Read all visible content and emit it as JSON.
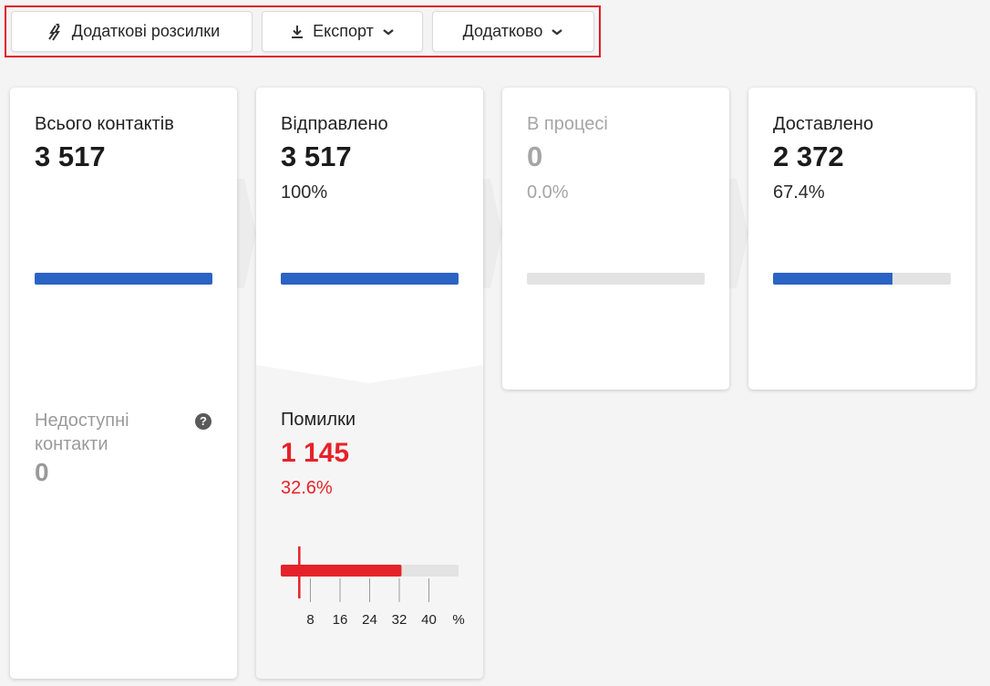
{
  "toolbar": {
    "additional_mailings": "Додаткові розсилки",
    "export": "Експорт",
    "more": "Додатково"
  },
  "cards": {
    "total": {
      "label": "Всього контактів",
      "value": "3 517"
    },
    "unavailable": {
      "label": "Недоступні контакти",
      "value": "0"
    },
    "sent": {
      "label": "Відправлено",
      "value": "3 517",
      "percent": "100%",
      "fill": 1.0
    },
    "in_progress": {
      "label": "В процесі",
      "value": "0",
      "percent": "0.0%",
      "fill": 0.0
    },
    "delivered": {
      "label": "Доставлено",
      "value": "2 372",
      "percent": "67.4%",
      "fill": 0.674
    },
    "errors": {
      "label": "Помилки",
      "value": "1 145",
      "percent": "32.6%",
      "fill_percent": 32.6,
      "marker_percent": 5,
      "scale_max": 48,
      "ticks": [
        "8",
        "16",
        "24",
        "32",
        "40"
      ],
      "unit": "%"
    }
  },
  "colors": {
    "accent_blue": "#2b63c5",
    "error_red": "#e5222a",
    "highlight_border": "#e01b24"
  },
  "icons": [
    "lightning-arrows-icon",
    "download-icon",
    "chevron-down-icon",
    "question-icon"
  ]
}
